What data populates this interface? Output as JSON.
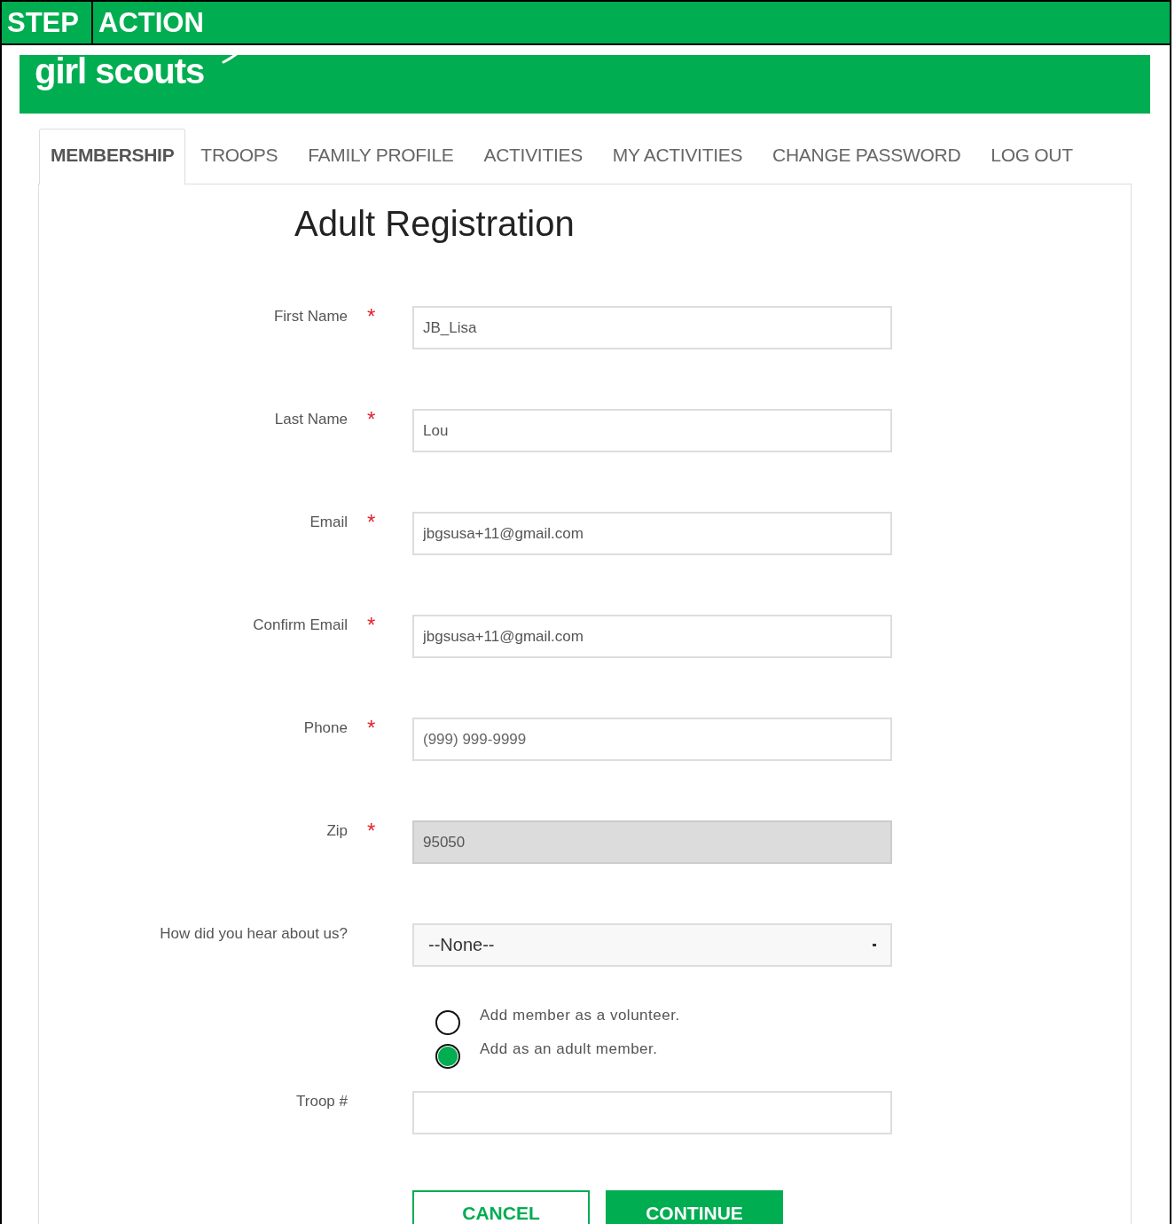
{
  "header": {
    "columns": [
      "STEP",
      "ACTION"
    ]
  },
  "brand": {
    "logo": "girl scouts"
  },
  "tabs": [
    {
      "label": "MEMBERSHIP",
      "selected": true
    },
    {
      "label": "TROOPS",
      "selected": false
    },
    {
      "label": "FAMILY PROFILE",
      "selected": false
    },
    {
      "label": "ACTIVITIES",
      "selected": false
    },
    {
      "label": "MY ACTIVITIES",
      "selected": false
    },
    {
      "label": "CHANGE PASSWORD",
      "selected": false
    },
    {
      "label": "LOG OUT",
      "selected": false
    }
  ],
  "form": {
    "title": "Adult Registration",
    "fields": [
      {
        "kind": "text",
        "label": "First Name",
        "required_mark": "*",
        "value": "JB_Lisa"
      },
      {
        "kind": "text",
        "label": "Last Name",
        "required_mark": "*",
        "value": "Lou"
      },
      {
        "kind": "text",
        "label": "Email",
        "required_mark": "*",
        "value": "jbgsusa+11@gmail.com"
      },
      {
        "kind": "text",
        "label": "Confirm Email",
        "required_mark": "*",
        "value": "jbgsusa+11@gmail.com"
      },
      {
        "kind": "text",
        "label": "Phone",
        "required_mark": "*",
        "placeholder": "(999) 999-9999"
      },
      {
        "kind": "readonly",
        "label": "Zip",
        "required_mark": "*",
        "value": "95050"
      },
      {
        "kind": "select",
        "label": "How did you hear about us?",
        "value": "--None--"
      }
    ],
    "options": [
      {
        "label": "Add member as a volunteer.",
        "selected": false
      },
      {
        "label": "Add as an adult member.",
        "selected": true
      }
    ],
    "troop": {
      "label": "Troop #"
    },
    "buttons": [
      {
        "kind": "secondary",
        "label": "CANCEL"
      },
      {
        "kind": "primary",
        "label": "CONTINUE"
      }
    ]
  }
}
